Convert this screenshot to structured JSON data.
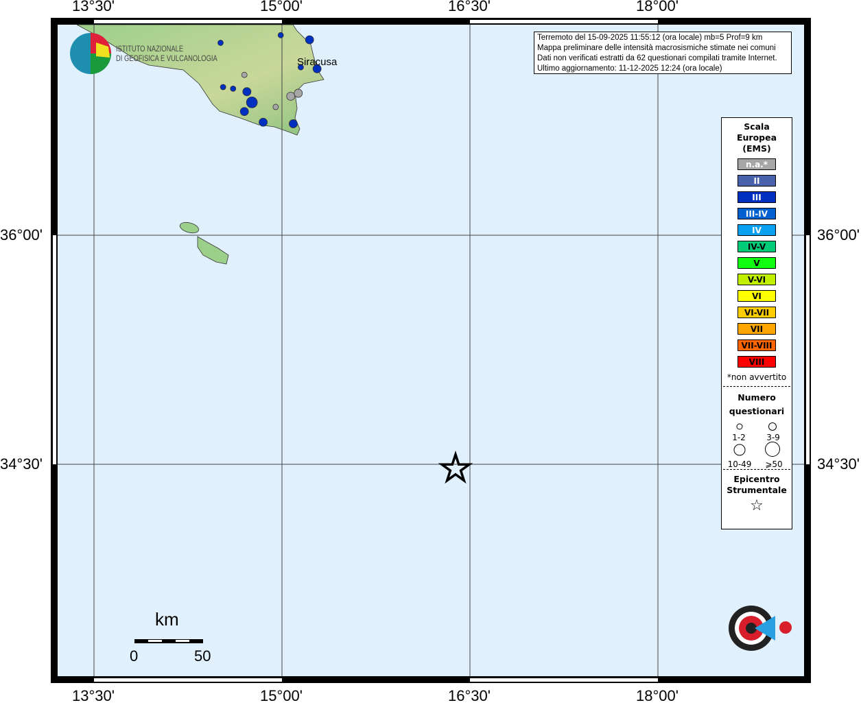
{
  "axes": {
    "lon_ticks": [
      "13°30'",
      "15°00'",
      "16°30'",
      "18°00'"
    ],
    "lat_ticks": [
      "36°00'",
      "34°30'"
    ]
  },
  "info": {
    "lines": [
      "Terremoto del 15-09-2025 11:55:12 (ora locale) mb=5 Prof=9 km",
      "Mappa preliminare delle intensità macrosismiche stimate nei comuni",
      "Dati non verificati estratti da 62 questionari compilati tramite Internet.",
      "Ultimo aggiornamento: 11-12-2025 12:24 (ora locale)"
    ]
  },
  "logo": {
    "line1": "ISTITUTO NAZIONALE",
    "line2": "DI GEOFISICA E VULCANOLOGIA"
  },
  "places": {
    "city": "Siracusa"
  },
  "legend": {
    "title": [
      "Scala",
      "Europea",
      "(EMS)"
    ],
    "scale": [
      {
        "label": "n.a.*",
        "color": "#a6a6a6",
        "text": "#fff"
      },
      {
        "label": "II",
        "color": "#4a62ac",
        "text": "#fff"
      },
      {
        "label": "III",
        "color": "#0030c0",
        "text": "#fff"
      },
      {
        "label": "III-IV",
        "color": "#0060d0",
        "text": "#fff"
      },
      {
        "label": "IV",
        "color": "#0aa0f0",
        "text": "#fff"
      },
      {
        "label": "IV-V",
        "color": "#00cc77",
        "text": "#000"
      },
      {
        "label": "V",
        "color": "#10ff10",
        "text": "#000"
      },
      {
        "label": "V-VI",
        "color": "#c0f000",
        "text": "#000"
      },
      {
        "label": "VI",
        "color": "#ffff00",
        "text": "#000"
      },
      {
        "label": "VI-VII",
        "color": "#ffcc00",
        "text": "#000"
      },
      {
        "label": "VII",
        "color": "#ffa500",
        "text": "#000"
      },
      {
        "label": "VII-VIII",
        "color": "#ff6600",
        "text": "#000"
      },
      {
        "label": "VIII",
        "color": "#ff0000",
        "text": "#000"
      }
    ],
    "note": "*non avvertito",
    "count_title": [
      "Numero",
      "questionari"
    ],
    "count_classes": [
      "1-2",
      "3-9",
      "10-49",
      "⩾50"
    ],
    "epi_title": [
      "Epicentro",
      "Strumentale"
    ]
  },
  "scalebar": {
    "unit": "km",
    "min": "0",
    "max": "50"
  },
  "sentito_logo": "haisentitoilterremoto.it www",
  "epicenter": {
    "lon": 16.385,
    "lat": 34.47
  },
  "points": [
    {
      "lon": 14.51,
      "lat": 37.26,
      "ems": "III",
      "n": "1-2"
    },
    {
      "lon": 14.99,
      "lat": 37.31,
      "ems": "III",
      "n": "1-2"
    },
    {
      "lon": 15.22,
      "lat": 37.28,
      "ems": "III",
      "n": "3-9"
    },
    {
      "lon": 15.15,
      "lat": 37.1,
      "ems": "III",
      "n": "1-2"
    },
    {
      "lon": 15.28,
      "lat": 37.09,
      "ems": "III",
      "n": "3-9"
    },
    {
      "lon": 14.7,
      "lat": 37.05,
      "ems": "n.a.*",
      "n": "1-2"
    },
    {
      "lon": 14.53,
      "lat": 36.97,
      "ems": "III",
      "n": "1-2"
    },
    {
      "lon": 14.61,
      "lat": 36.96,
      "ems": "III",
      "n": "1-2"
    },
    {
      "lon": 14.72,
      "lat": 36.94,
      "ems": "III",
      "n": "3-9"
    },
    {
      "lon": 14.76,
      "lat": 36.87,
      "ems": "III",
      "n": "10-49"
    },
    {
      "lon": 15.07,
      "lat": 36.91,
      "ems": "n.a.*",
      "n": "3-9"
    },
    {
      "lon": 15.13,
      "lat": 36.93,
      "ems": "n.a.*",
      "n": "3-9"
    },
    {
      "lon": 14.95,
      "lat": 36.84,
      "ems": "n.a.*",
      "n": "1-2"
    },
    {
      "lon": 14.7,
      "lat": 36.81,
      "ems": "III",
      "n": "3-9"
    },
    {
      "lon": 14.85,
      "lat": 36.74,
      "ems": "III",
      "n": "3-9"
    },
    {
      "lon": 15.09,
      "lat": 36.73,
      "ems": "III",
      "n": "3-9"
    }
  ]
}
